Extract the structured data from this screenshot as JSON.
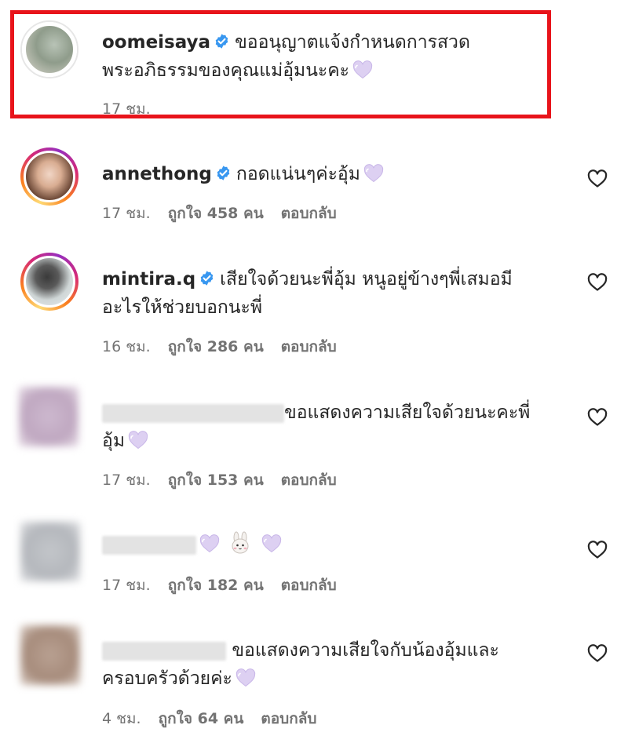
{
  "colors": {
    "highlight": "#e8141b",
    "verified": "#3897f0",
    "meta_text": "#737373",
    "heart_emoji": "#d9c8f0"
  },
  "comments": [
    {
      "username": "oomeisaya",
      "verified": true,
      "text_line1": "ขออนุญาตแจ้งกำหนดการสวด",
      "text_line2": "พระอภิธรรมของคุณแม่อุ้มนะคะ",
      "time": "17 ชม.",
      "emoji": "light-purple-heart-icon"
    },
    {
      "username": "annethong",
      "verified": true,
      "text_line1": "กอดแน่นๆค่ะอุ้ม",
      "time": "17 ชม.",
      "likes": "ถูกใจ 458 คน",
      "reply": "ตอบกลับ",
      "emoji": "light-purple-heart-icon"
    },
    {
      "username": "mintira.q",
      "verified": true,
      "text_line1": "เสียใจด้วยนะพี่อุ้ม หนูอยู่ข้างๆพี่เสมอมี",
      "text_line2": "อะไรให้ช่วยบอกนะพี่",
      "time": "16 ชม.",
      "likes": "ถูกใจ 286 คน",
      "reply": "ตอบกลับ"
    },
    {
      "text_line1": "ขอแสดงความเสียใจด้วยนะคะพี่",
      "text_line2": "อุ้ม",
      "time": "17 ชม.",
      "likes": "ถูกใจ 153 คน",
      "reply": "ตอบกลับ",
      "emoji": "light-purple-heart-icon"
    },
    {
      "time": "17 ชม.",
      "likes": "ถูกใจ 182 คน",
      "reply": "ตอบกลับ",
      "emoji": "light-purple-heart-icon"
    },
    {
      "text_line1": "ขอแสดงความเสียใจกับน้องอุ้มและ",
      "text_line2": "ครอบครัวด้วยค่ะ",
      "time": "4 ชม.",
      "likes": "ถูกใจ 64 คน",
      "reply": "ตอบกลับ",
      "emoji": "light-purple-heart-icon"
    }
  ]
}
